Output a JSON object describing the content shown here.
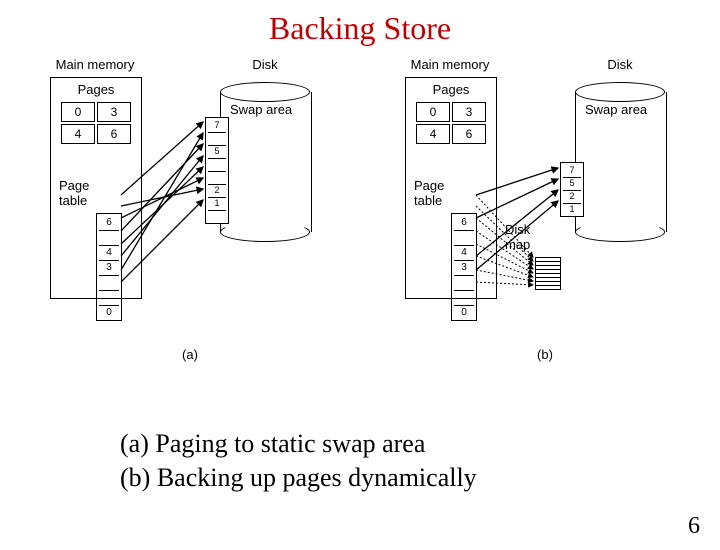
{
  "title": "Backing Store",
  "labels": {
    "main_memory": "Main memory",
    "disk": "Disk",
    "pages": "Pages",
    "swap_area": "Swap area",
    "page_table": "Page\ntable",
    "disk_map": "Disk\nmap"
  },
  "cells": {
    "p00": "0",
    "p01": "3",
    "p10": "4",
    "p11": "6",
    "pt0": "6",
    "pt1": "",
    "pt2": "4",
    "pt3": "3",
    "pt4": "",
    "pt5": "",
    "pt6": "0",
    "sw_a0": "7",
    "sw_a1": "",
    "sw_a2": "5",
    "sw_a3": "",
    "sw_a4": "",
    "sw_a5": "2",
    "sw_a6": "1",
    "sw_a7": "",
    "sw_b0": "7",
    "sw_b1": "5",
    "sw_b2": "2",
    "sw_b3": "1"
  },
  "subpanel": {
    "a": "(a)",
    "b": "(b)"
  },
  "captions": {
    "a": "(a) Paging to static swap area",
    "b": "(b) Backing up pages dynamically"
  },
  "page_number": "6"
}
